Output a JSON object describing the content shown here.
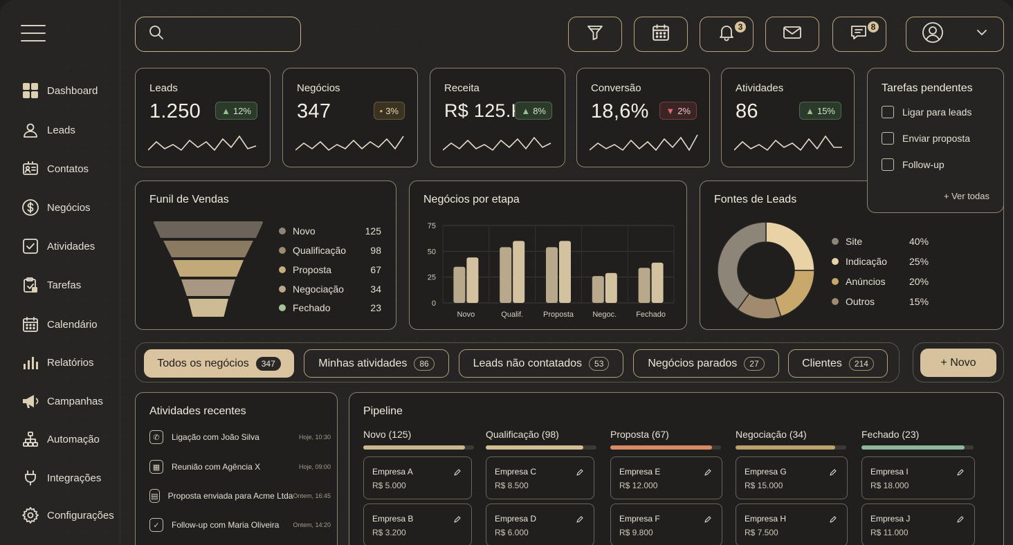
{
  "nav": {
    "items": [
      {
        "label": "Dashboard",
        "icon": "dashboard-icon"
      },
      {
        "label": "Leads",
        "icon": "user-icon"
      },
      {
        "label": "Contatos",
        "icon": "contacts-icon"
      },
      {
        "label": "Negócios",
        "icon": "dollar-icon"
      },
      {
        "label": "Atividades",
        "icon": "checkbox-icon"
      },
      {
        "label": "Tarefas",
        "icon": "clipboard-icon"
      },
      {
        "label": "Calendário",
        "icon": "calendar-icon"
      },
      {
        "label": "Relatórios",
        "icon": "bar-chart-icon"
      },
      {
        "label": "Campanhas",
        "icon": "megaphone-icon"
      },
      {
        "label": "Automação",
        "icon": "hierarchy-icon"
      },
      {
        "label": "Integrações",
        "icon": "plug-icon"
      },
      {
        "label": "Configurações",
        "icon": "gear-icon"
      }
    ]
  },
  "topbar": {
    "search_placeholder": "",
    "notifications_count": "3",
    "messages_count": "8"
  },
  "kpis": [
    {
      "title": "Leads",
      "value": "1.250",
      "change": "12%",
      "trend": "up"
    },
    {
      "title": "Negócios",
      "value": "347",
      "change": "3%",
      "trend": "neutral"
    },
    {
      "title": "Receita",
      "value": "R$ 125.K",
      "change": "8%",
      "trend": "up"
    },
    {
      "title": "Conversão",
      "value": "18,6%",
      "change": "2%",
      "trend": "down"
    },
    {
      "title": "Atividades",
      "value": "86",
      "change": "15%",
      "trend": "up"
    }
  ],
  "tasks": {
    "title": "Tarefas pendentes",
    "items": [
      "Ligar para leads",
      "Enviar proposta",
      "Follow-up"
    ],
    "see_all": "+ Ver todas"
  },
  "funnel": {
    "title": "Funil de Vendas",
    "stages": [
      {
        "label": "Novo",
        "value": "125",
        "color": "#8e857a"
      },
      {
        "label": "Qualificação",
        "value": "98",
        "color": "#9c8b6e"
      },
      {
        "label": "Proposta",
        "value": "67",
        "color": "#c6ad7c"
      },
      {
        "label": "Negociação",
        "value": "34",
        "color": "#b8a88a"
      },
      {
        "label": "Fechado",
        "value": "23",
        "color": "#a9c29a"
      }
    ]
  },
  "chart_data": {
    "type": "bar",
    "title": "Negócios por etapa",
    "categories": [
      "Novo",
      "Qualif.",
      "Proposta",
      "Negoc.",
      "Fechado"
    ],
    "series": [
      {
        "values": [
          35,
          54,
          54,
          26,
          34
        ]
      },
      {
        "values": [
          44,
          60,
          60,
          29,
          39
        ]
      }
    ],
    "yticks": [
      "0",
      "25",
      "50",
      "75"
    ],
    "ylim": [
      0,
      75
    ],
    "grid": true
  },
  "sources": {
    "title": "Fontes de Leads",
    "items": [
      {
        "label": "Site",
        "value": "40%",
        "pct": 40,
        "color": "#8d8578"
      },
      {
        "label": "Indicação",
        "value": "25%",
        "pct": 25,
        "color": "#e9d3a6"
      },
      {
        "label": "Anúncios",
        "value": "20%",
        "pct": 20,
        "color": "#c8a86b"
      },
      {
        "label": "Outros",
        "value": "15%",
        "pct": 15,
        "color": "#a08b6e"
      }
    ]
  },
  "filters": [
    {
      "label": "Todos os negócios",
      "count": "347",
      "active": true
    },
    {
      "label": "Minhas atividades",
      "count": "86"
    },
    {
      "label": "Leads não contatados",
      "count": "53"
    },
    {
      "label": "Negócios parados",
      "count": "27"
    },
    {
      "label": "Clientes",
      "count": "214"
    }
  ],
  "new_button": "+ Novo",
  "recent": {
    "title": "Atividades recentes",
    "items": [
      {
        "text": "Ligação com João Silva",
        "time": "Hoje, 10:30"
      },
      {
        "text": "Reunião com Agência X",
        "time": "Hoje, 09:00"
      },
      {
        "text": "Proposta enviada para Acme Ltda",
        "time": "Ontem, 16:45"
      },
      {
        "text": "Follow-up com Maria Oliveira",
        "time": "Ontem, 14:20"
      }
    ]
  },
  "pipeline": {
    "title": "Pipeline",
    "columns": [
      {
        "title": "Novo (125)",
        "color": "#c9b790",
        "cards": [
          {
            "name": "Empresa A",
            "value": "R$ 5.000"
          },
          {
            "name": "Empresa B",
            "value": "R$ 3.200"
          }
        ]
      },
      {
        "title": "Qualificação (98)",
        "color": "#d2c094",
        "cards": [
          {
            "name": "Empresa C",
            "value": "R$ 8.500"
          },
          {
            "name": "Empresa D",
            "value": "R$ 6.000"
          }
        ]
      },
      {
        "title": "Proposta (67)",
        "color": "#d78c66",
        "cards": [
          {
            "name": "Empresa E",
            "value": "R$ 12.000"
          },
          {
            "name": "Empresa F",
            "value": "R$ 9.800"
          }
        ]
      },
      {
        "title": "Negociação (34)",
        "color": "#b9a36d",
        "cards": [
          {
            "name": "Empresa G",
            "value": "R$ 15.000"
          },
          {
            "name": "Empresa H",
            "value": "R$ 7.500"
          }
        ]
      },
      {
        "title": "Fechado (23)",
        "color": "#8db89a",
        "cards": [
          {
            "name": "Empresa I",
            "value": "R$ 18.000"
          },
          {
            "name": "Empresa J",
            "value": "R$ 11.000"
          }
        ]
      }
    ]
  }
}
